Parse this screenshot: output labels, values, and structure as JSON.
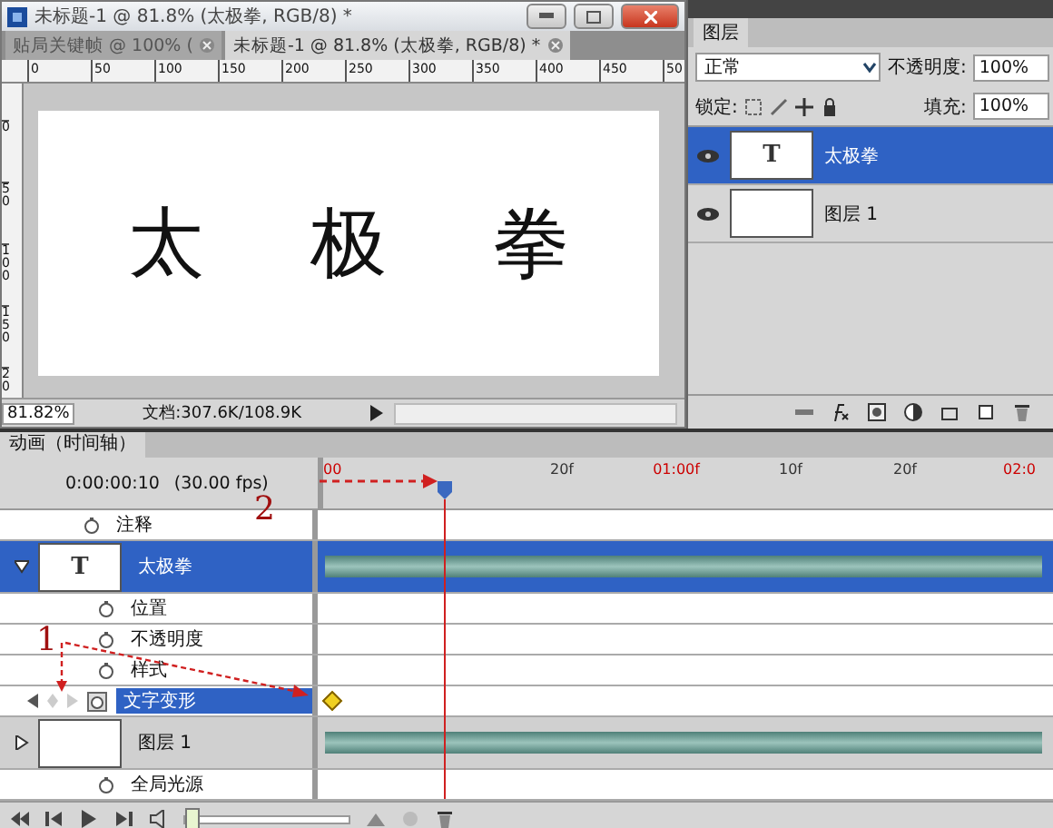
{
  "document_window": {
    "title": "未标题-1 @ 81.8% (太极拳, RGB/8) *",
    "tabs": [
      {
        "label": "贴局关键帧 @ 100% (",
        "selected": false
      },
      {
        "label": "未标题-1 @ 81.8% (太极拳, RGB/8) *",
        "selected": true
      }
    ],
    "ruler_h": [
      "0",
      "50",
      "100",
      "150",
      "200",
      "250",
      "300",
      "350",
      "400",
      "450",
      "50"
    ],
    "ruler_v": [
      "0",
      "50",
      "100",
      "150",
      "20"
    ],
    "canvas_text": [
      "太",
      "极",
      "拳"
    ],
    "zoom": "81.82%",
    "doc_info": "文档:307.6K/108.9K"
  },
  "layers_panel": {
    "tab": "图层",
    "blend_mode": "正常",
    "opacity_label": "不透明度:",
    "opacity": "100%",
    "lock_label": "锁定:",
    "fill_label": "填充:",
    "fill": "100%",
    "layers": [
      {
        "name": "太极拳",
        "thumb_text": "T",
        "selected": true
      },
      {
        "name": "图层 1",
        "selected": false
      }
    ]
  },
  "timeline": {
    "tab": "动画（时间轴）",
    "time": "0:00:00:10",
    "fps": "(30.00 fps)",
    "ruler": [
      {
        "label": "00",
        "red": true
      },
      {
        "label": "20f",
        "red": false
      },
      {
        "label": "01:00f",
        "red": true
      },
      {
        "label": "10f",
        "red": false
      },
      {
        "label": "20f",
        "red": false
      },
      {
        "label": "02:0",
        "red": true
      }
    ],
    "tracks": [
      {
        "kind": "property",
        "name": "注释",
        "selected": false,
        "keyframe": false
      },
      {
        "kind": "layer",
        "name": "太极拳",
        "thumb_text": "T",
        "selected": true,
        "expanded": true
      },
      {
        "kind": "property",
        "name": "位置",
        "selected": false,
        "keyframe": false
      },
      {
        "kind": "property",
        "name": "不透明度",
        "selected": false,
        "keyframe": false
      },
      {
        "kind": "property",
        "name": "样式",
        "selected": false,
        "keyframe": false
      },
      {
        "kind": "property",
        "name": "文字变形",
        "selected": true,
        "keyframe": true
      },
      {
        "kind": "layer",
        "name": "图层 1",
        "selected": false,
        "expanded": false
      },
      {
        "kind": "property",
        "name": "全局光源",
        "selected": false,
        "keyframe": false
      }
    ],
    "zoom_slider": {
      "level": 0
    },
    "annotations": [
      {
        "label": "2"
      },
      {
        "label": "1"
      }
    ]
  }
}
